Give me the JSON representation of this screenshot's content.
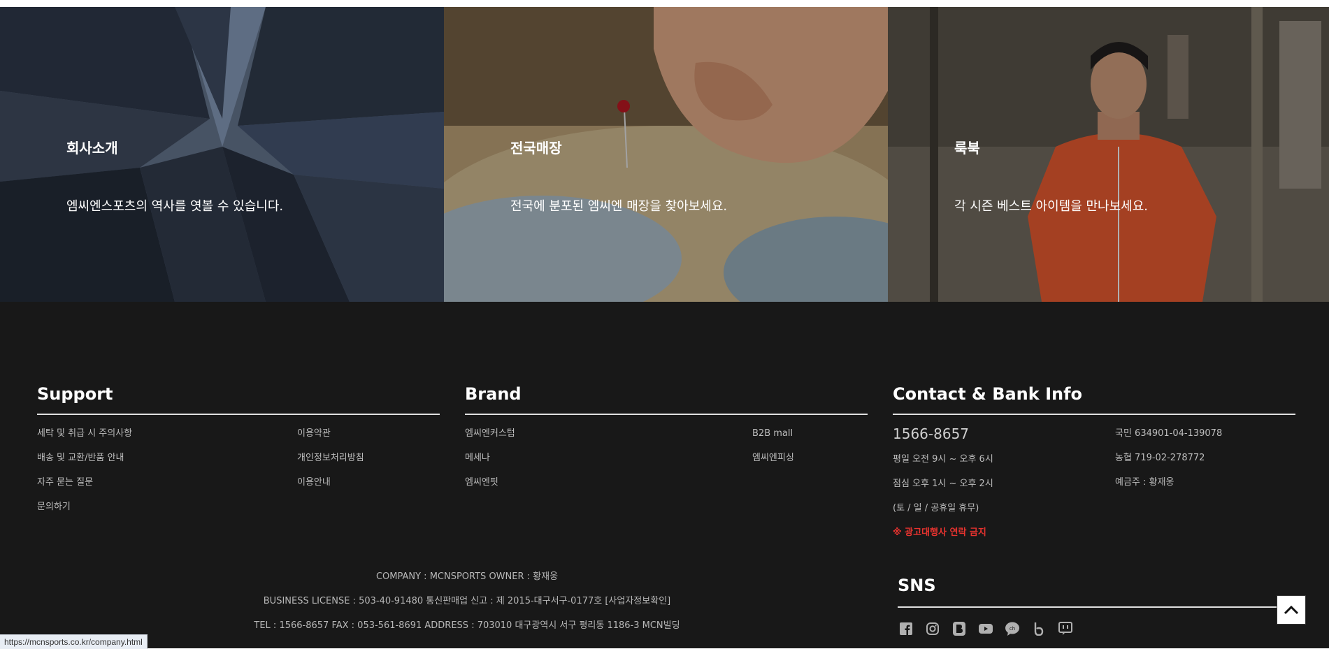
{
  "banners": [
    {
      "title": "회사소개",
      "desc": "엠씨엔스포츠의 역사를 엿볼 수 있습니다."
    },
    {
      "title": "전국매장",
      "desc": "전국에 분포된 엠씨엔 매장을 찾아보세요."
    },
    {
      "title": "룩북",
      "desc": "각 시즌 베스트 아이템을 만나보세요."
    }
  ],
  "support": {
    "heading": "Support",
    "left": [
      "세탁 및 취급 시 주의사항",
      "배송 및 교환/반품 안내",
      "자주 묻는 질문",
      "문의하기"
    ],
    "right": [
      "이용약관",
      "개인정보처리방침",
      "이용안내"
    ]
  },
  "brand": {
    "heading": "Brand",
    "left": [
      "엠씨엔커스텀",
      "메세나",
      "엠씨엔핏"
    ],
    "right": [
      "B2B mall",
      "엠씨엔피싱"
    ]
  },
  "contact": {
    "heading": "Contact & Bank Info",
    "phone": "1566-8657",
    "hours": [
      "평일 오전 9시 ~ 오후 6시",
      "점심 오후 1시 ~ 오후 2시",
      "(토 / 일 / 공휴일 휴무)"
    ],
    "warning": "※ 광고대행사 연락 금지",
    "bank": [
      "국민 634901-04-139078",
      "농협 719-02-278772",
      "예금주 : 황재웅"
    ]
  },
  "company": {
    "line1": "COMPANY : MCNSPORTS OWNER : 황재웅",
    "line2": "BUSINESS LICENSE : 503-40-91480 통신판매업 신고 : 제 2015-대구서구-0177호 [사업자정보확인]",
    "line3": "TEL : 1566-8657 FAX : 053-561-8691 ADDRESS : 703010 대구광역시 서구 평리동 1186-3 MCN빌딩"
  },
  "sns": {
    "heading": "SNS",
    "icons": [
      "facebook-icon",
      "instagram-icon",
      "blog-icon",
      "youtube-icon",
      "kakao-channel-icon",
      "band-icon",
      "kakaotalk-icon"
    ]
  },
  "status_url": "https://mcnsports.co.kr/company.html"
}
